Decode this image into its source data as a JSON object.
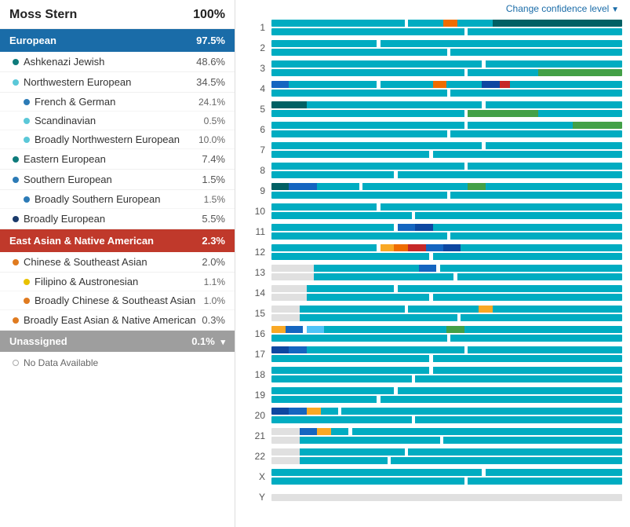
{
  "person": {
    "name": "Moss Stern",
    "total": "100%"
  },
  "change_confidence_label": "Change confidence level",
  "categories": [
    {
      "id": "european",
      "label": "European",
      "value": "97.5%",
      "color": "european",
      "subcategories": [
        {
          "label": "Ashkenazi Jewish",
          "value": "48.6%",
          "dot": "dot-dark-teal",
          "children": []
        },
        {
          "label": "Northwestern European",
          "value": "34.5%",
          "dot": "dot-light-blue",
          "children": [
            {
              "label": "French & German",
              "value": "24.1%",
              "dot": "dot-mid-blue"
            },
            {
              "label": "Scandinavian",
              "value": "0.5%",
              "dot": "dot-light-blue"
            },
            {
              "label": "Broadly Northwestern European",
              "value": "10.0%",
              "dot": "dot-light-blue"
            }
          ]
        },
        {
          "label": "Eastern European",
          "value": "7.4%",
          "dot": "dot-dark-teal",
          "children": []
        },
        {
          "label": "Southern European",
          "value": "1.5%",
          "dot": "dot-mid-blue",
          "children": [
            {
              "label": "Broadly Southern European",
              "value": "1.5%",
              "dot": "dot-mid-blue"
            }
          ]
        },
        {
          "label": "Broadly European",
          "value": "5.5%",
          "dot": "dot-dark-blue",
          "children": []
        }
      ]
    },
    {
      "id": "east-asian",
      "label": "East Asian & Native American",
      "value": "2.3%",
      "color": "east-asian",
      "subcategories": [
        {
          "label": "Chinese & Southeast Asian",
          "value": "2.0%",
          "dot": "dot-orange",
          "children": [
            {
              "label": "Filipino & Austronesian",
              "value": "1.1%",
              "dot": "dot-yellow"
            },
            {
              "label": "Broadly Chinese & Southeast Asian",
              "value": "1.0%",
              "dot": "dot-orange"
            }
          ]
        },
        {
          "label": "Broadly East Asian & Native American",
          "value": "0.3%",
          "dot": "dot-orange",
          "children": []
        }
      ]
    }
  ],
  "unassigned": {
    "label": "Unassigned",
    "value": "0.1%"
  },
  "no_data_label": "No Data Available",
  "chromosomes": [
    {
      "id": "1",
      "bars": [
        [
          [
            "c-teal",
            38
          ],
          [
            "c-dot-marker",
            1
          ],
          [
            "c-teal",
            10
          ],
          [
            "c-orange",
            4
          ],
          [
            "c-teal",
            10
          ],
          [
            "c-dark-teal",
            37
          ]
        ],
        [
          [
            "c-teal",
            55
          ],
          [
            "c-dot-marker",
            1
          ],
          [
            "c-teal",
            44
          ]
        ]
      ]
    },
    {
      "id": "2",
      "bars": [
        [
          [
            "c-teal",
            30
          ],
          [
            "c-dot-marker",
            1
          ],
          [
            "c-teal",
            69
          ]
        ],
        [
          [
            "c-teal",
            50
          ],
          [
            "c-dot-marker",
            1
          ],
          [
            "c-teal",
            49
          ]
        ]
      ]
    },
    {
      "id": "3",
      "bars": [
        [
          [
            "c-teal",
            60
          ],
          [
            "c-dot-marker",
            1
          ],
          [
            "c-teal",
            39
          ]
        ],
        [
          [
            "c-teal",
            55
          ],
          [
            "c-dot-marker",
            1
          ],
          [
            "c-teal",
            20
          ],
          [
            "c-mid-green",
            24
          ]
        ]
      ]
    },
    {
      "id": "4",
      "bars": [
        [
          [
            "c-blue",
            5
          ],
          [
            "c-teal",
            25
          ],
          [
            "c-dot-marker",
            1
          ],
          [
            "c-teal",
            15
          ],
          [
            "c-orange",
            4
          ],
          [
            "c-teal",
            10
          ],
          [
            "c-dark-blue",
            5
          ],
          [
            "c-red",
            3
          ],
          [
            "c-teal",
            32
          ]
        ],
        [
          [
            "c-teal",
            50
          ],
          [
            "c-dot-marker",
            1
          ],
          [
            "c-teal",
            49
          ]
        ]
      ]
    },
    {
      "id": "5",
      "bars": [
        [
          [
            "c-dark-teal",
            10
          ],
          [
            "c-teal",
            50
          ],
          [
            "c-dot-marker",
            1
          ],
          [
            "c-teal",
            39
          ]
        ],
        [
          [
            "c-teal",
            55
          ],
          [
            "c-dot-marker",
            1
          ],
          [
            "c-mid-green",
            20
          ],
          [
            "c-teal",
            24
          ]
        ]
      ]
    },
    {
      "id": "6",
      "bars": [
        [
          [
            "c-teal",
            55
          ],
          [
            "c-dot-marker",
            1
          ],
          [
            "c-teal",
            30
          ],
          [
            "c-mid-green",
            14
          ]
        ],
        [
          [
            "c-teal",
            50
          ],
          [
            "c-dot-marker",
            1
          ],
          [
            "c-teal",
            49
          ]
        ]
      ]
    },
    {
      "id": "7",
      "bars": [
        [
          [
            "c-teal",
            60
          ],
          [
            "c-dot-marker",
            1
          ],
          [
            "c-teal",
            39
          ]
        ],
        [
          [
            "c-teal",
            45
          ],
          [
            "c-dot-marker",
            1
          ],
          [
            "c-teal",
            54
          ]
        ]
      ]
    },
    {
      "id": "8",
      "bars": [
        [
          [
            "c-teal",
            55
          ],
          [
            "c-dot-marker",
            1
          ],
          [
            "c-teal",
            44
          ]
        ],
        [
          [
            "c-teal",
            35
          ],
          [
            "c-dot-marker",
            1
          ],
          [
            "c-teal",
            64
          ]
        ]
      ]
    },
    {
      "id": "9",
      "bars": [
        [
          [
            "c-dark-teal",
            5
          ],
          [
            "c-blue",
            8
          ],
          [
            "c-teal",
            12
          ],
          [
            "c-dot-marker",
            1
          ],
          [
            "c-teal",
            30
          ],
          [
            "c-mid-green",
            5
          ],
          [
            "c-teal",
            39
          ]
        ],
        [
          [
            "c-teal",
            50
          ],
          [
            "c-dot-marker",
            1
          ],
          [
            "c-teal",
            49
          ]
        ]
      ]
    },
    {
      "id": "10",
      "bars": [
        [
          [
            "c-teal",
            30
          ],
          [
            "c-dot-marker",
            1
          ],
          [
            "c-teal",
            69
          ]
        ],
        [
          [
            "c-teal",
            40
          ],
          [
            "c-dot-marker",
            1
          ],
          [
            "c-teal",
            59
          ]
        ]
      ]
    },
    {
      "id": "11",
      "bars": [
        [
          [
            "c-teal",
            35
          ],
          [
            "c-dot-marker",
            1
          ],
          [
            "c-blue",
            5
          ],
          [
            "c-dark-blue",
            5
          ],
          [
            "c-teal",
            54
          ]
        ],
        [
          [
            "c-teal",
            50
          ],
          [
            "c-dot-marker",
            1
          ],
          [
            "c-teal",
            49
          ]
        ]
      ]
    },
    {
      "id": "12",
      "bars": [
        [
          [
            "c-teal",
            30
          ],
          [
            "c-dot-marker",
            1
          ],
          [
            "c-yellow",
            4
          ],
          [
            "c-orange",
            4
          ],
          [
            "c-red",
            5
          ],
          [
            "c-blue",
            5
          ],
          [
            "c-dark-blue",
            5
          ],
          [
            "c-teal",
            46
          ]
        ],
        [
          [
            "c-teal",
            45
          ],
          [
            "c-dot-marker",
            1
          ],
          [
            "c-teal",
            54
          ]
        ]
      ]
    },
    {
      "id": "13",
      "bars": [
        [
          [
            "c-gray",
            12
          ],
          [
            "c-teal",
            30
          ],
          [
            "c-blue",
            5
          ],
          [
            "c-dot-marker",
            1
          ],
          [
            "c-teal",
            52
          ]
        ],
        [
          [
            "c-gray",
            12
          ],
          [
            "c-teal",
            40
          ],
          [
            "c-dot-marker",
            1
          ],
          [
            "c-teal",
            47
          ]
        ]
      ]
    },
    {
      "id": "14",
      "bars": [
        [
          [
            "c-gray",
            10
          ],
          [
            "c-teal",
            25
          ],
          [
            "c-dot-marker",
            1
          ],
          [
            "c-teal",
            64
          ]
        ],
        [
          [
            "c-gray",
            10
          ],
          [
            "c-teal",
            35
          ],
          [
            "c-dot-marker",
            1
          ],
          [
            "c-teal",
            54
          ]
        ]
      ]
    },
    {
      "id": "15",
      "bars": [
        [
          [
            "c-gray",
            8
          ],
          [
            "c-teal",
            30
          ],
          [
            "c-dot-marker",
            1
          ],
          [
            "c-teal",
            20
          ],
          [
            "c-yellow",
            4
          ],
          [
            "c-teal",
            37
          ]
        ],
        [
          [
            "c-gray",
            8
          ],
          [
            "c-teal",
            45
          ],
          [
            "c-dot-marker",
            1
          ],
          [
            "c-teal",
            46
          ]
        ]
      ]
    },
    {
      "id": "16",
      "bars": [
        [
          [
            "c-yellow",
            4
          ],
          [
            "c-blue",
            5
          ],
          [
            "c-dot-marker",
            1
          ],
          [
            "c-light-blue",
            5
          ],
          [
            "c-teal",
            35
          ],
          [
            "c-mid-green",
            5
          ],
          [
            "c-teal",
            45
          ]
        ],
        [
          [
            "c-teal",
            50
          ],
          [
            "c-dot-marker",
            1
          ],
          [
            "c-teal",
            49
          ]
        ]
      ]
    },
    {
      "id": "17",
      "bars": [
        [
          [
            "c-dark-blue",
            5
          ],
          [
            "c-blue",
            5
          ],
          [
            "c-teal",
            45
          ],
          [
            "c-dot-marker",
            1
          ],
          [
            "c-teal",
            44
          ]
        ],
        [
          [
            "c-teal",
            45
          ],
          [
            "c-dot-marker",
            1
          ],
          [
            "c-teal",
            54
          ]
        ]
      ]
    },
    {
      "id": "18",
      "bars": [
        [
          [
            "c-teal",
            45
          ],
          [
            "c-dot-marker",
            1
          ],
          [
            "c-teal",
            54
          ]
        ],
        [
          [
            "c-teal",
            40
          ],
          [
            "c-dot-marker",
            1
          ],
          [
            "c-teal",
            59
          ]
        ]
      ]
    },
    {
      "id": "19",
      "bars": [
        [
          [
            "c-teal",
            35
          ],
          [
            "c-dot-marker",
            1
          ],
          [
            "c-teal",
            64
          ]
        ],
        [
          [
            "c-teal",
            30
          ],
          [
            "c-dot-marker",
            1
          ],
          [
            "c-teal",
            69
          ]
        ]
      ]
    },
    {
      "id": "20",
      "bars": [
        [
          [
            "c-dark-blue",
            5
          ],
          [
            "c-blue",
            5
          ],
          [
            "c-yellow",
            4
          ],
          [
            "c-teal",
            5
          ],
          [
            "c-dot-marker",
            1
          ],
          [
            "c-teal",
            80
          ]
        ],
        [
          [
            "c-teal",
            40
          ],
          [
            "c-dot-marker",
            1
          ],
          [
            "c-teal",
            59
          ]
        ]
      ]
    },
    {
      "id": "21",
      "bars": [
        [
          [
            "c-gray",
            8
          ],
          [
            "c-blue",
            5
          ],
          [
            "c-yellow",
            4
          ],
          [
            "c-teal",
            5
          ],
          [
            "c-dot-marker",
            1
          ],
          [
            "c-teal",
            77
          ]
        ],
        [
          [
            "c-gray",
            8
          ],
          [
            "c-teal",
            40
          ],
          [
            "c-dot-marker",
            1
          ],
          [
            "c-teal",
            51
          ]
        ]
      ]
    },
    {
      "id": "22",
      "bars": [
        [
          [
            "c-gray",
            8
          ],
          [
            "c-teal",
            30
          ],
          [
            "c-dot-marker",
            1
          ],
          [
            "c-teal",
            61
          ]
        ],
        [
          [
            "c-gray",
            8
          ],
          [
            "c-teal",
            25
          ],
          [
            "c-dot-marker",
            1
          ],
          [
            "c-teal",
            66
          ]
        ]
      ]
    },
    {
      "id": "X",
      "bars": [
        [
          [
            "c-teal",
            60
          ],
          [
            "c-dot-marker",
            1
          ],
          [
            "c-teal",
            39
          ]
        ],
        [
          [
            "c-teal",
            55
          ],
          [
            "c-dot-marker",
            1
          ],
          [
            "c-teal",
            44
          ]
        ]
      ]
    },
    {
      "id": "Y",
      "bars": [
        [
          [
            "c-gray",
            100
          ]
        ],
        []
      ]
    }
  ]
}
